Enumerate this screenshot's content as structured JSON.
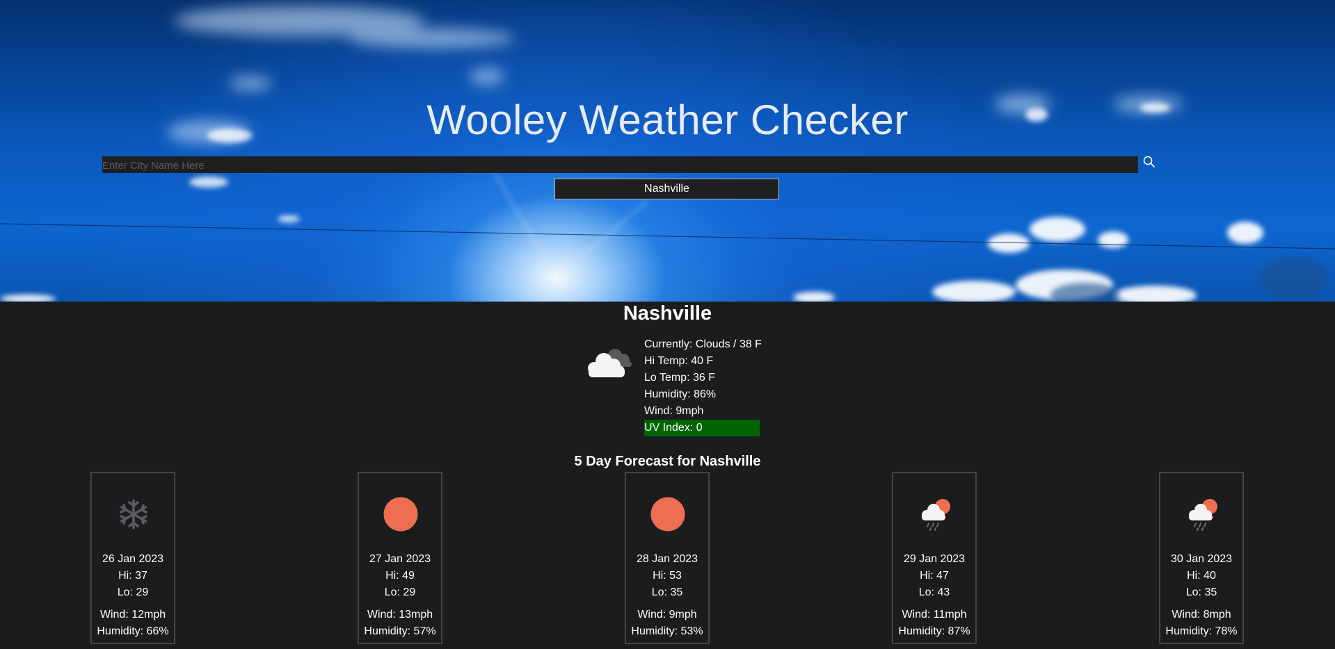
{
  "app": {
    "title": "Wooley Weather Checker"
  },
  "search": {
    "placeholder": "Enter City Name Here",
    "value": "",
    "icon": "search-icon"
  },
  "history": [
    {
      "label": "Nashville"
    }
  ],
  "current": {
    "city": "Nashville",
    "icon": "clouds-icon",
    "conditions": "Currently: Clouds / 38 F",
    "hi": "Hi Temp: 40 F",
    "lo": "Lo Temp: 36 F",
    "humidity": "Humidity: 86%",
    "wind": "Wind: 9mph",
    "uv": "UV Index: 0",
    "uv_color": "#006400"
  },
  "forecast_title": "5 Day Forecast for Nashville",
  "forecast": [
    {
      "icon": "snow-icon",
      "date": "26 Jan 2023",
      "hi": "Hi: 37",
      "lo": "Lo: 29",
      "wind": "Wind: 12mph",
      "humidity": "Humidity: 66%"
    },
    {
      "icon": "sun-icon",
      "date": "27 Jan 2023",
      "hi": "Hi: 49",
      "lo": "Lo: 29",
      "wind": "Wind: 13mph",
      "humidity": "Humidity: 57%"
    },
    {
      "icon": "sun-icon",
      "date": "28 Jan 2023",
      "hi": "Hi: 53",
      "lo": "Lo: 35",
      "wind": "Wind: 9mph",
      "humidity": "Humidity: 53%"
    },
    {
      "icon": "rain-sun-icon",
      "date": "29 Jan 2023",
      "hi": "Hi: 47",
      "lo": "Lo: 43",
      "wind": "Wind: 11mph",
      "humidity": "Humidity: 87%"
    },
    {
      "icon": "rain-sun-icon",
      "date": "30 Jan 2023",
      "hi": "Hi: 40",
      "lo": "Lo: 35",
      "wind": "Wind: 8mph",
      "humidity": "Humidity: 78%"
    }
  ],
  "colors": {
    "background": "#1b1c1e",
    "sun": "#ee6e52",
    "card_border": "#444446",
    "sky": "#0a56b8"
  }
}
